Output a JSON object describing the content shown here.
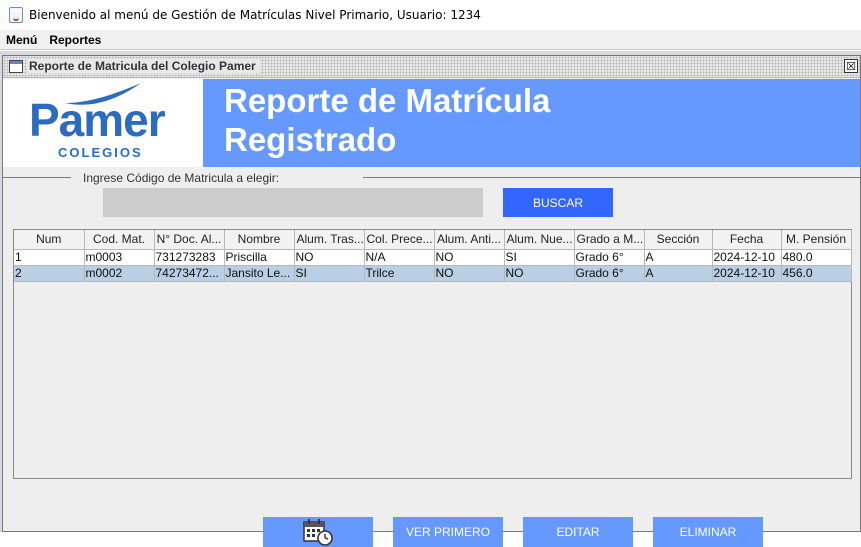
{
  "window": {
    "title": "Bienvenido al menú de Gestión de Matrículas Nivel Primario, Usuario: 1234"
  },
  "menubar": {
    "items": [
      "Menú",
      "Reportes"
    ]
  },
  "internal_frame": {
    "title": "Reporte de Matricula del Colegio Pamer",
    "close_glyph": "☒"
  },
  "logo": {
    "word": "Pamer",
    "subtitle": "COLEGIOS"
  },
  "banner": {
    "title": "Reporte de Matrícula\nRegistrado"
  },
  "search": {
    "label": "Ingrese Código de Matricula a elegir:",
    "value": "",
    "button": "BUSCAR"
  },
  "table": {
    "headers": [
      "Num",
      "Cod. Mat.",
      "N° Doc. Al...",
      "Nombre",
      "Alum. Tras...",
      "Col. Prece...",
      "Alum. Anti...",
      "Alum. Nue...",
      "Grado a M...",
      "Sección",
      "Fecha",
      "M. Pensión"
    ],
    "rows": [
      [
        "1",
        "m0003",
        "731273283",
        "Priscilla",
        "NO",
        "N/A",
        "NO",
        "SI",
        "Grado 6°",
        "A",
        "2024-12-10",
        "480.0"
      ],
      [
        "2",
        "m0002",
        "74273472...",
        "Jansito Le...",
        "SI",
        "Trilce",
        "NO",
        "NO",
        "Grado 6°",
        "A",
        "2024-12-10",
        "456.0"
      ]
    ],
    "selected_row": 1
  },
  "actions": {
    "calendar_icon": "calendar-clock-icon",
    "ver_primero": "VER PRIMERO",
    "editar": "EDITAR",
    "eliminar": "ELIMINAR"
  },
  "colors": {
    "banner": "#6699ff",
    "logo_blue": "#2d6bc0",
    "search_button": "#3366ff",
    "action_buttons": "#6699ff",
    "selected_row": "#b8cfe5"
  }
}
